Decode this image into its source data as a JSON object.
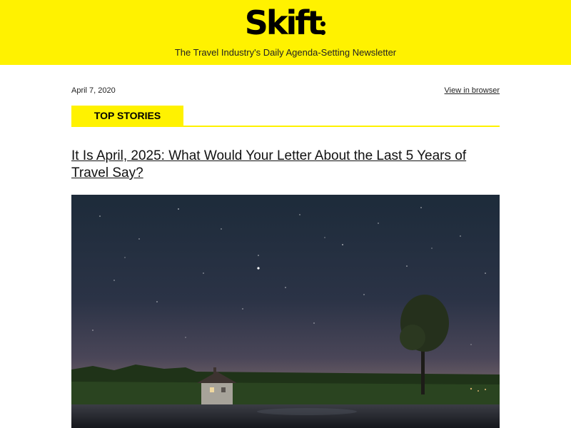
{
  "header": {
    "logo_text": "Skift",
    "tagline": "The Travel Industry's Daily Agenda-Setting Newsletter",
    "background_color": "#fff200"
  },
  "meta": {
    "date": "April 7, 2020",
    "view_in_browser": "View in browser"
  },
  "section": {
    "label": "TOP STORIES",
    "accent_color": "#fff200"
  },
  "story": {
    "headline": "It Is April, 2025: What Would Your Letter About the Last 5 Years of Travel Say?",
    "image": "night-sky-house-lake-photo"
  }
}
